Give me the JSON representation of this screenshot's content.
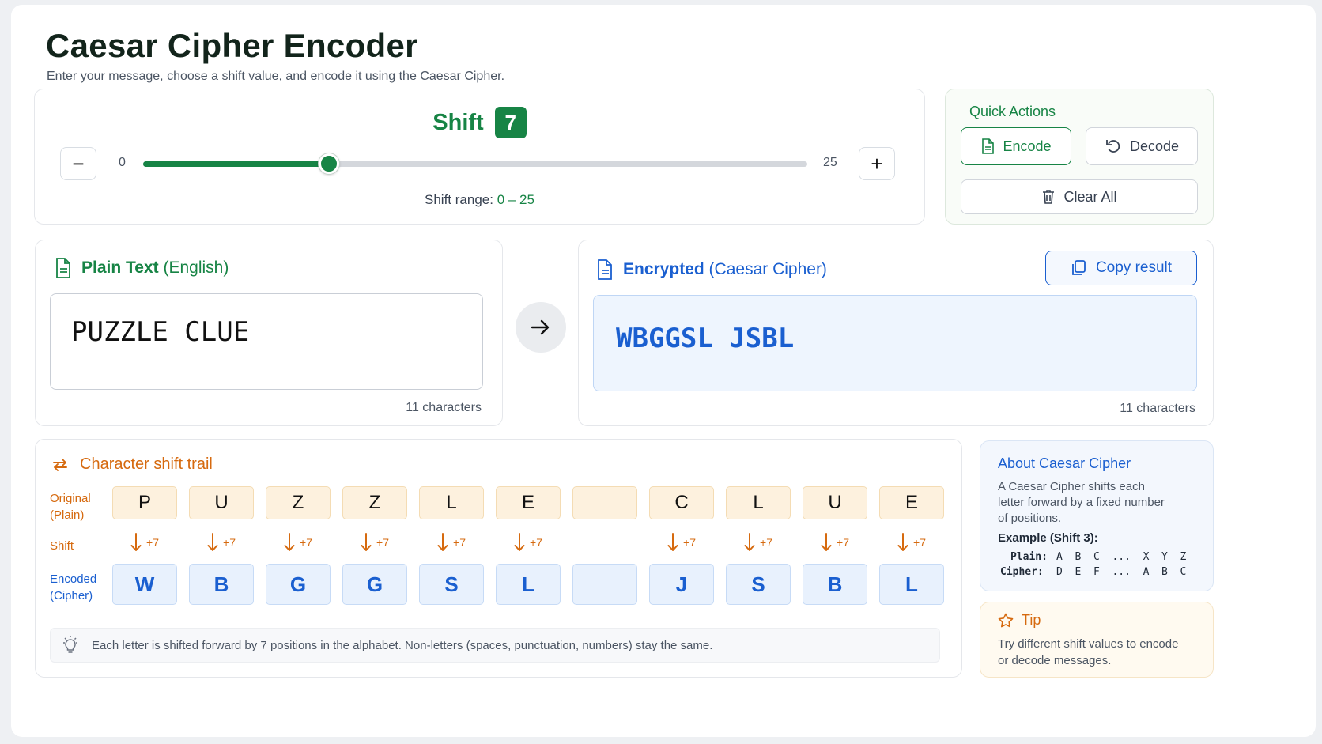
{
  "app": {
    "title": "Caesar Cipher Encoder",
    "subtitle": "Enter your message, choose a shift value, and encode it using the Caesar Cipher."
  },
  "shift": {
    "label": "Shift",
    "value": "7",
    "value_num": 7,
    "min": "0",
    "max": "25",
    "min_num": 0,
    "max_num": 25,
    "minus_glyph": "−",
    "plus_glyph": "+",
    "range_note_prefix": "Shift range:",
    "range_note_value": "0 – 25"
  },
  "quick_actions": {
    "title": "Quick Actions",
    "encode": "Encode",
    "decode": "Decode",
    "clear": "Clear All"
  },
  "plain": {
    "title": "Plain Text",
    "title_suffix": "(English)",
    "value": "PUZZLE CLUE",
    "count": "11 characters"
  },
  "encrypted": {
    "title": "Encrypted",
    "title_suffix": "(Caesar Cipher)",
    "value": "WBGGSL JSBL",
    "count": "11 characters",
    "copy": "Copy result"
  },
  "trail": {
    "title": "Character shift trail",
    "label_original_1": "Original",
    "label_original_2": "(Plain)",
    "label_shift": "Shift",
    "label_encoded_1": "Encoded",
    "label_encoded_2": "(Cipher)",
    "original": [
      "P",
      "U",
      "Z",
      "Z",
      "L",
      "E",
      "",
      "C",
      "L",
      "U",
      "E"
    ],
    "encoded": [
      "W",
      "B",
      "G",
      "G",
      "S",
      "L",
      "",
      "J",
      "S",
      "B",
      "L"
    ],
    "shift_tag": "+7",
    "note": "Each letter is shifted forward by 7 positions in the alphabet. Non-letters (spaces, punctuation, numbers) stay the same."
  },
  "about": {
    "title": "About Caesar Cipher",
    "body": "A Caesar Cipher shifts each letter forward by a fixed number of positions.",
    "example_title": "Example (Shift 3):",
    "plain_label": "Plain:",
    "plain_row": "A  B  C  ...  X  Y  Z",
    "cipher_label": "Cipher:",
    "cipher_row": "D  E  F  ...  A  B  C"
  },
  "tip": {
    "title": "Tip",
    "body": "Try different shift values to encode or decode messages."
  },
  "colors": {
    "green": "#178445",
    "blue": "#1a5fd0",
    "orange": "#d66a0f"
  }
}
